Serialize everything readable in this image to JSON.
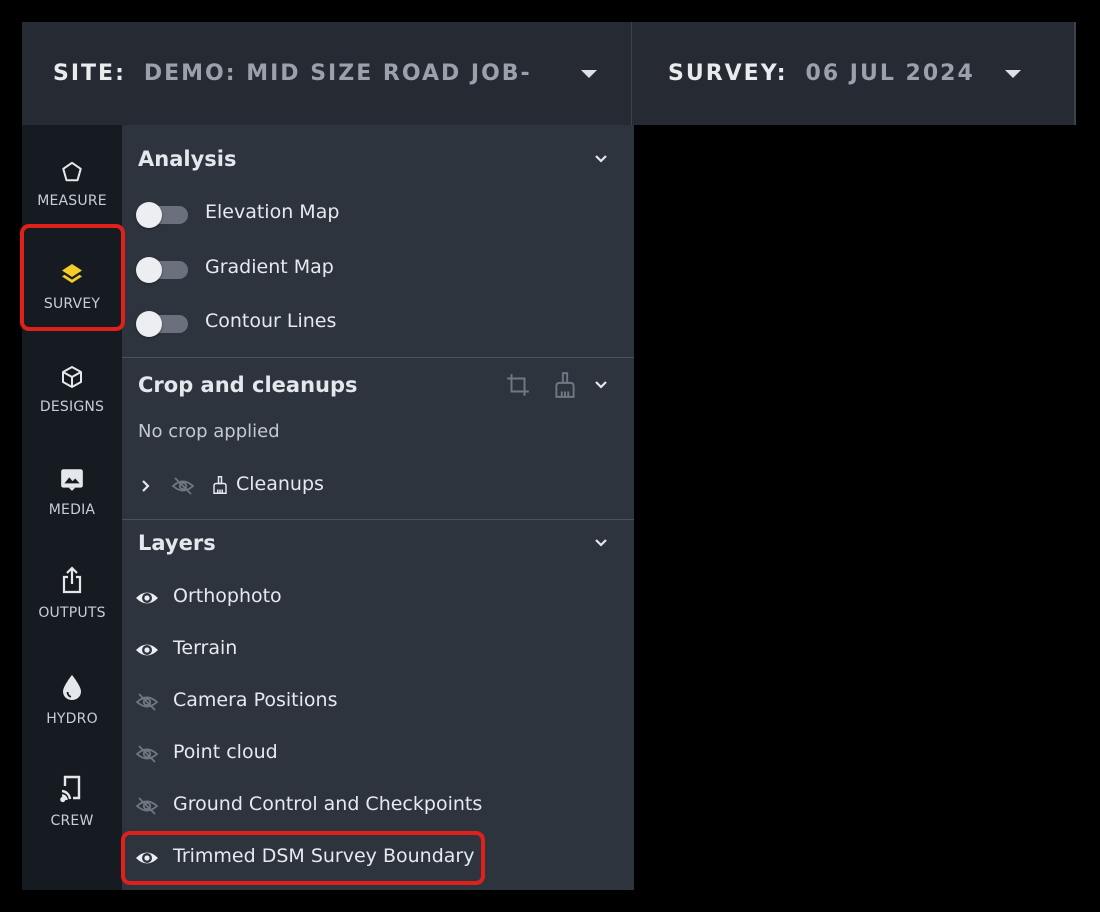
{
  "topbar": {
    "site_label": "SITE:",
    "site_value": "DEMO: MID SIZE ROAD JOB-",
    "survey_label": "SURVEY:",
    "survey_value": "06 JUL 2024"
  },
  "rail": {
    "items": [
      {
        "label": "MEASURE",
        "icon": "pentagon-icon"
      },
      {
        "label": "SURVEY",
        "icon": "layers-icon",
        "active": true
      },
      {
        "label": "DESIGNS",
        "icon": "cube-icon"
      },
      {
        "label": "MEDIA",
        "icon": "image-icon"
      },
      {
        "label": "OUTPUTS",
        "icon": "share-icon"
      },
      {
        "label": "HYDRO",
        "icon": "water-drop-icon"
      },
      {
        "label": "CREW",
        "icon": "cast-icon"
      }
    ],
    "active_color": "#f4cc2a"
  },
  "analysis": {
    "title": "Analysis",
    "toggles": [
      {
        "label": "Elevation Map",
        "on": false
      },
      {
        "label": "Gradient Map",
        "on": false
      },
      {
        "label": "Contour Lines",
        "on": false
      }
    ]
  },
  "crop": {
    "title": "Crop and cleanups",
    "status": "No crop applied",
    "cleanups_label": "Cleanups"
  },
  "layers": {
    "title": "Layers",
    "items": [
      {
        "label": "Orthophoto",
        "visible": true
      },
      {
        "label": "Terrain",
        "visible": true
      },
      {
        "label": "Camera Positions",
        "visible": false
      },
      {
        "label": "Point cloud",
        "visible": false
      },
      {
        "label": "Ground Control and Checkpoints",
        "visible": false
      },
      {
        "label": "Trimmed DSM Survey Boundary",
        "visible": true
      }
    ]
  },
  "highlight_color": "#e0201b"
}
